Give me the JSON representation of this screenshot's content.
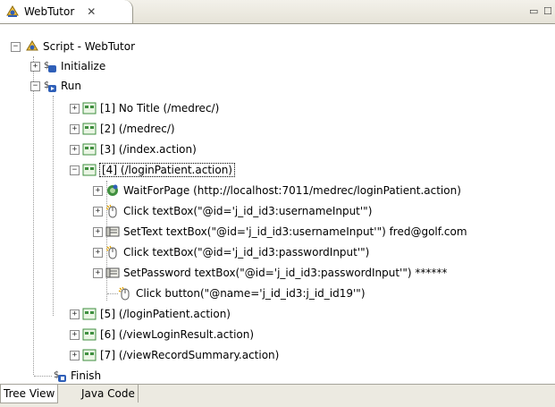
{
  "editor_tab": {
    "title": "WebTutor",
    "close_glyph": "✕",
    "icon": "webtutor-icon"
  },
  "window_controls": {
    "minimize": "▭",
    "maximize": "☐"
  },
  "tree": {
    "root": {
      "label": "Script - WebTutor",
      "toggle": "−"
    },
    "initialize": {
      "label": "Initialize",
      "toggle": "+"
    },
    "run": {
      "label": "Run",
      "toggle": "−"
    },
    "pages": [
      {
        "label": "[1] No Title (/medrec/)",
        "toggle": "+"
      },
      {
        "label": "[2] (/medrec/)",
        "toggle": "+"
      },
      {
        "label": "[3] (/index.action)",
        "toggle": "+"
      },
      {
        "label": "[4] (/loginPatient.action)",
        "toggle": "−"
      }
    ],
    "steps": [
      {
        "label": "WaitForPage (http://localhost:7011/medrec/loginPatient.action)",
        "toggle": "+",
        "icon": "wait-icon"
      },
      {
        "label": "Click textBox(\"@id='j_id_id3:usernameInput'\")",
        "toggle": "+",
        "icon": "click-icon"
      },
      {
        "label": "SetText textBox(\"@id='j_id_id3:usernameInput'\") fred@golf.com",
        "toggle": "+",
        "icon": "settext-icon"
      },
      {
        "label": "Click textBox(\"@id='j_id_id3:passwordInput'\")",
        "toggle": "+",
        "icon": "click-icon"
      },
      {
        "label": "SetPassword textBox(\"@id='j_id_id3:passwordInput'\") ******",
        "toggle": "+",
        "icon": "settext-icon"
      },
      {
        "label": "Click button(\"@name='j_id_id3:j_id_id19'\")",
        "toggle": "",
        "icon": "click-icon"
      }
    ],
    "pages_after": [
      {
        "label": "[5] (/loginPatient.action)",
        "toggle": "+"
      },
      {
        "label": "[6] (/viewLoginResult.action)",
        "toggle": "+"
      },
      {
        "label": "[7] (/viewRecordSummary.action)",
        "toggle": "+"
      }
    ],
    "finish": {
      "label": "Finish"
    }
  },
  "bottom_tabs": {
    "tree_view": "Tree View",
    "java_code": "Java Code",
    "active": "Tree View"
  },
  "colors": {
    "accent_blue": "#2f5fb8",
    "page_green": "#3f8f3f"
  }
}
